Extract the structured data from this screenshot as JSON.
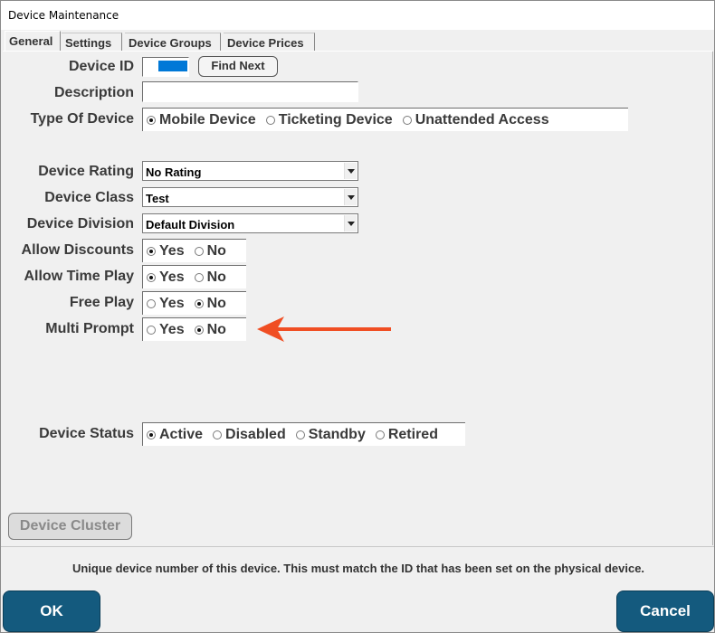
{
  "window": {
    "title": "Device Maintenance"
  },
  "tabs": [
    {
      "label": "General",
      "active": true
    },
    {
      "label": "Settings",
      "active": false
    },
    {
      "label": "Device Groups",
      "active": false
    },
    {
      "label": "Device Prices",
      "active": false
    }
  ],
  "form": {
    "device_id": {
      "label": "Device ID",
      "value": "",
      "find_next_label": "Find Next"
    },
    "description": {
      "label": "Description",
      "value": ""
    },
    "type_of_device": {
      "label": "Type Of Device",
      "options": [
        "Mobile Device",
        "Ticketing Device",
        "Unattended Access"
      ],
      "selected": "Mobile Device"
    },
    "device_rating": {
      "label": "Device Rating",
      "value": "No Rating"
    },
    "device_class": {
      "label": "Device Class",
      "value": "Test"
    },
    "device_division": {
      "label": "Device Division",
      "value": "Default Division"
    },
    "allow_discounts": {
      "label": "Allow Discounts",
      "yes": "Yes",
      "no": "No",
      "selected": "Yes"
    },
    "allow_time_play": {
      "label": "Allow Time Play",
      "yes": "Yes",
      "no": "No",
      "selected": "Yes"
    },
    "free_play": {
      "label": "Free Play",
      "yes": "Yes",
      "no": "No",
      "selected": "No"
    },
    "multi_prompt": {
      "label": "Multi Prompt",
      "yes": "Yes",
      "no": "No",
      "selected": "No"
    },
    "device_status": {
      "label": "Device Status",
      "options": [
        "Active",
        "Disabled",
        "Standby",
        "Retired"
      ],
      "selected": "Active"
    },
    "device_cluster_label": "Device Cluster"
  },
  "status_hint": "Unique device number of this device.  This must match the ID that has been set on the physical device.",
  "footer": {
    "ok_label": "OK",
    "cancel_label": "Cancel"
  },
  "colors": {
    "accent": "#145a7e",
    "arrow": "#f04e23",
    "selection": "#0078d7"
  }
}
